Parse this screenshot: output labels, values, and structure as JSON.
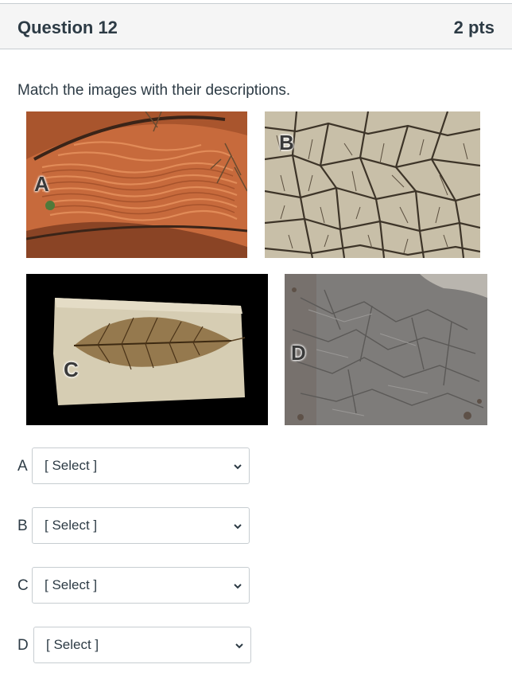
{
  "question": {
    "title": "Question 12",
    "points": "2 pts"
  },
  "prompt": "Match the images with their descriptions.",
  "images": [
    {
      "letter": "A",
      "subject": "rippled red sand"
    },
    {
      "letter": "B",
      "subject": "cracked dry mud"
    },
    {
      "letter": "C",
      "subject": "fossil leaf in stone"
    },
    {
      "letter": "D",
      "subject": "wrinkled gray rock surface"
    }
  ],
  "matches": [
    {
      "label": "A",
      "selected": "[ Select ]"
    },
    {
      "label": "B",
      "selected": "[ Select ]"
    },
    {
      "label": "C",
      "selected": "[ Select ]"
    },
    {
      "label": "D",
      "selected": "[ Select ]"
    }
  ]
}
